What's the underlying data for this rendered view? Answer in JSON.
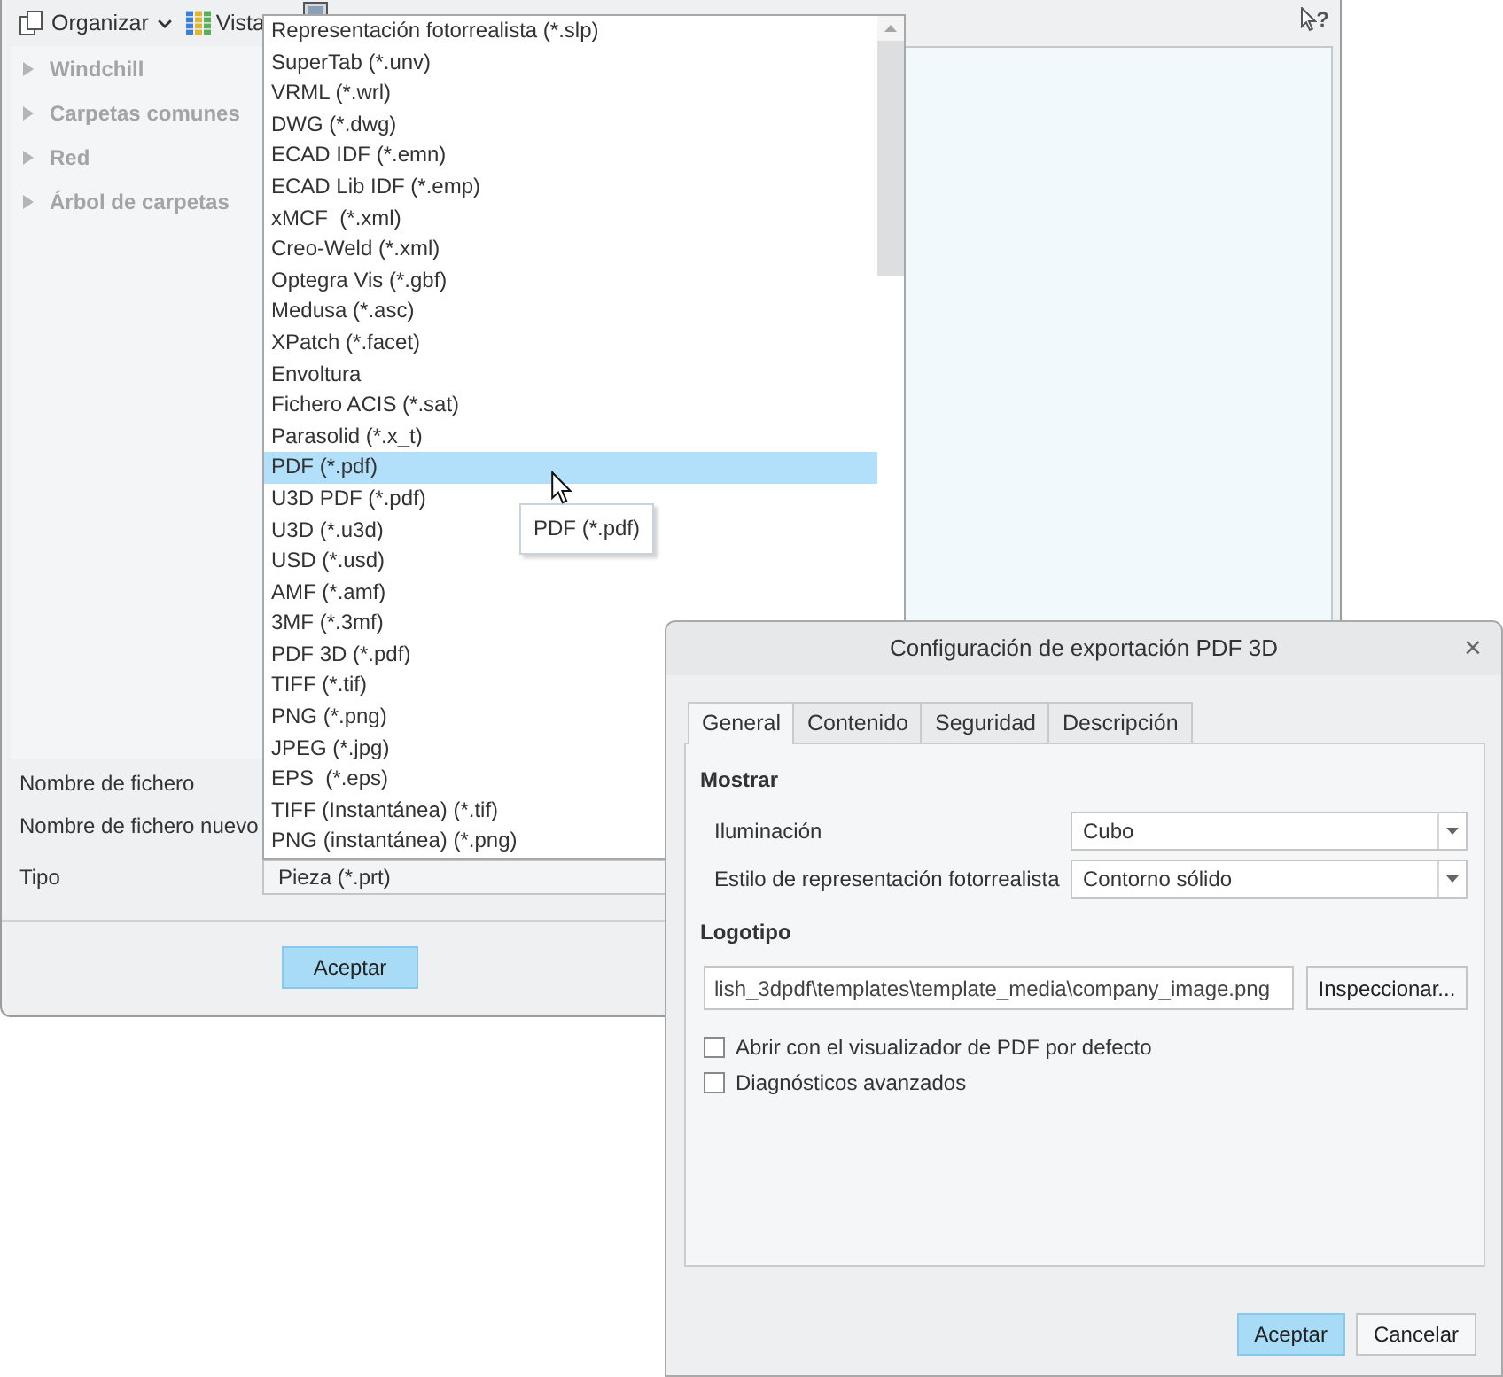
{
  "file_window": {
    "toolbar": {
      "organize": {
        "label": "Organizar"
      },
      "view": {
        "label": "Vista"
      },
      "help": {
        "glyph": "?"
      }
    },
    "sidebar": {
      "items": [
        {
          "label": "Windchill",
          "expanded": false
        },
        {
          "label": "Carpetas comunes",
          "expanded": false
        },
        {
          "label": "Red",
          "expanded": false
        },
        {
          "label": "Árbol de carpetas",
          "expanded": false
        }
      ]
    },
    "form": {
      "fields": [
        {
          "label": "Nombre de fichero"
        },
        {
          "label": "Nombre de fichero nuevo"
        },
        {
          "label": "Tipo",
          "value": "Pieza (*.prt)"
        }
      ]
    },
    "buttons": [
      {
        "label": "Aceptar",
        "default": true
      }
    ]
  },
  "type_dropdown": {
    "options": [
      {
        "label": "Representación fotorrealista (*.slp)",
        "selected": false
      },
      {
        "label": "SuperTab (*.unv)",
        "selected": false
      },
      {
        "label": "VRML (*.wrl)",
        "selected": false
      },
      {
        "label": "DWG (*.dwg)",
        "selected": false
      },
      {
        "label": "ECAD IDF (*.emn)",
        "selected": false
      },
      {
        "label": "ECAD Lib IDF (*.emp)",
        "selected": false
      },
      {
        "label": "xMCF  (*.xml)",
        "selected": false
      },
      {
        "label": "Creo-Weld (*.xml)",
        "selected": false
      },
      {
        "label": "Optegra Vis (*.gbf)",
        "selected": false
      },
      {
        "label": "Medusa (*.asc)",
        "selected": false
      },
      {
        "label": "XPatch (*.facet)",
        "selected": false
      },
      {
        "label": "Envoltura",
        "selected": false
      },
      {
        "label": "Fichero ACIS (*.sat)",
        "selected": false
      },
      {
        "label": "Parasolid (*.x_t)",
        "selected": false
      },
      {
        "label": "PDF (*.pdf)",
        "selected": true
      },
      {
        "label": "U3D PDF (*.pdf)",
        "selected": false
      },
      {
        "label": "U3D (*.u3d)",
        "selected": false
      },
      {
        "label": "USD (*.usd)",
        "selected": false
      },
      {
        "label": "AMF (*.amf)",
        "selected": false
      },
      {
        "label": "3MF (*.3mf)",
        "selected": false
      },
      {
        "label": "PDF 3D (*.pdf)",
        "selected": false
      },
      {
        "label": "TIFF (*.tif)",
        "selected": false
      },
      {
        "label": "PNG (*.png)",
        "selected": false
      },
      {
        "label": "JPEG (*.jpg)",
        "selected": false
      },
      {
        "label": "EPS  (*.eps)",
        "selected": false
      },
      {
        "label": "TIFF (Instantánea) (*.tif)",
        "selected": false
      },
      {
        "label": "PNG (instantánea) (*.png)",
        "selected": false
      }
    ]
  },
  "tooltip": {
    "text": "PDF (*.pdf)"
  },
  "dialog": {
    "title": "Configuración de exportación PDF 3D",
    "close_glyph": "×",
    "tabs": [
      {
        "label": "General",
        "selected": true
      },
      {
        "label": "Contenido",
        "selected": false
      },
      {
        "label": "Seguridad",
        "selected": false
      },
      {
        "label": "Descripción",
        "selected": false
      }
    ],
    "sections": [
      {
        "heading": "Mostrar",
        "fields": [
          {
            "kind": "select",
            "label": "Iluminación",
            "value": "Cubo"
          },
          {
            "kind": "select",
            "label": "Estilo de representación fotorrealista",
            "value": "Contorno sólido"
          }
        ]
      },
      {
        "heading": "Logotipo",
        "fields": [
          {
            "kind": "file",
            "value": "lish_3dpdf\\templates\\template_media\\company_image.png",
            "button": "Inspeccionar..."
          }
        ]
      }
    ],
    "options": [
      {
        "label": "Abrir con el visualizador de PDF por defecto",
        "checked": false
      },
      {
        "label": "Diagnósticos avanzados",
        "checked": false
      }
    ],
    "buttons": [
      {
        "label": "Aceptar",
        "default": true
      },
      {
        "label": "Cancelar",
        "default": false
      }
    ]
  }
}
